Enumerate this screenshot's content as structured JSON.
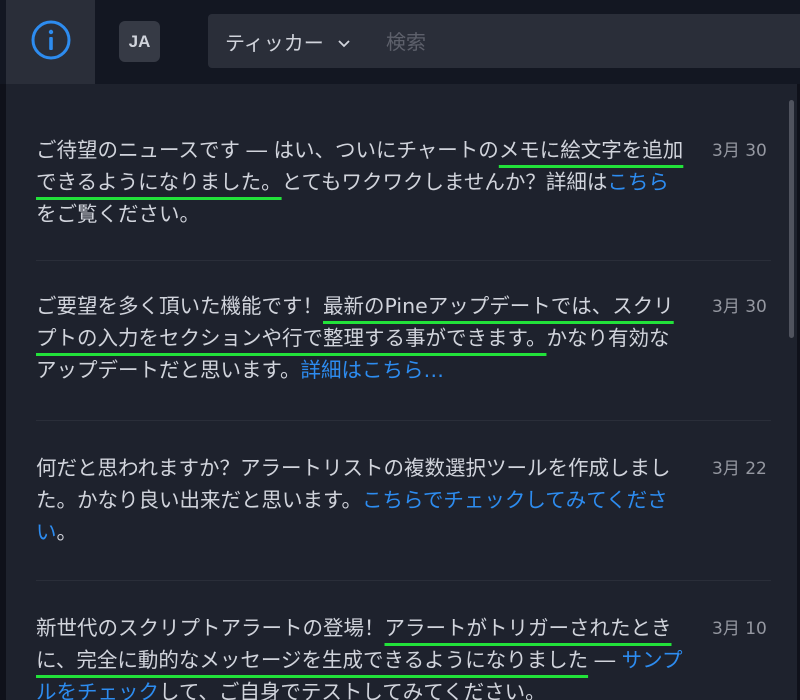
{
  "header": {
    "lang_label": "JA",
    "ticker_label": "ティッカー",
    "search_placeholder": "検索"
  },
  "colors": {
    "accent": "#2d8cf0",
    "highlight_underline": "#22e23a",
    "panel_bg": "#1e222d"
  },
  "news": [
    {
      "parts": [
        {
          "t": "ご待望のニュースです ― はい、ついにチャートの"
        },
        {
          "t": "メモに絵文字を追加できるようになりました。",
          "hl": true
        },
        {
          "t": "とてもワクワクしませんか？詳細は"
        },
        {
          "t": "こちら",
          "link": true
        },
        {
          "t": "をご覧ください。"
        }
      ],
      "date": "3月 30"
    },
    {
      "parts": [
        {
          "t": "ご要望を多く頂いた機能です！"
        },
        {
          "t": "最新のPineアップデートでは、スクリプトの入力をセクションや行で整理する事ができます。",
          "hl": true
        },
        {
          "t": "かなり有効なアップデートだと思います。"
        },
        {
          "t": "詳細はこちら…",
          "link": true
        }
      ],
      "date": "3月 30"
    },
    {
      "parts": [
        {
          "t": "何だと思われますか？アラートリストの複数選択ツールを作成しました。かなり良い出来だと思います。"
        },
        {
          "t": "こちらでチェックしてみてください",
          "link": true
        },
        {
          "t": "。"
        }
      ],
      "date": "3月 22"
    },
    {
      "parts": [
        {
          "t": "新世代のスクリプトアラートの登場！"
        },
        {
          "t": "アラートがトリガーされたときに、完全に動的なメッセージを生成できるようになりました",
          "hl": true
        },
        {
          "t": " ― "
        },
        {
          "t": "サンプルをチェック",
          "link": true
        },
        {
          "t": "して、ご自身でテストしてみてください。"
        }
      ],
      "date": "3月 10"
    }
  ]
}
